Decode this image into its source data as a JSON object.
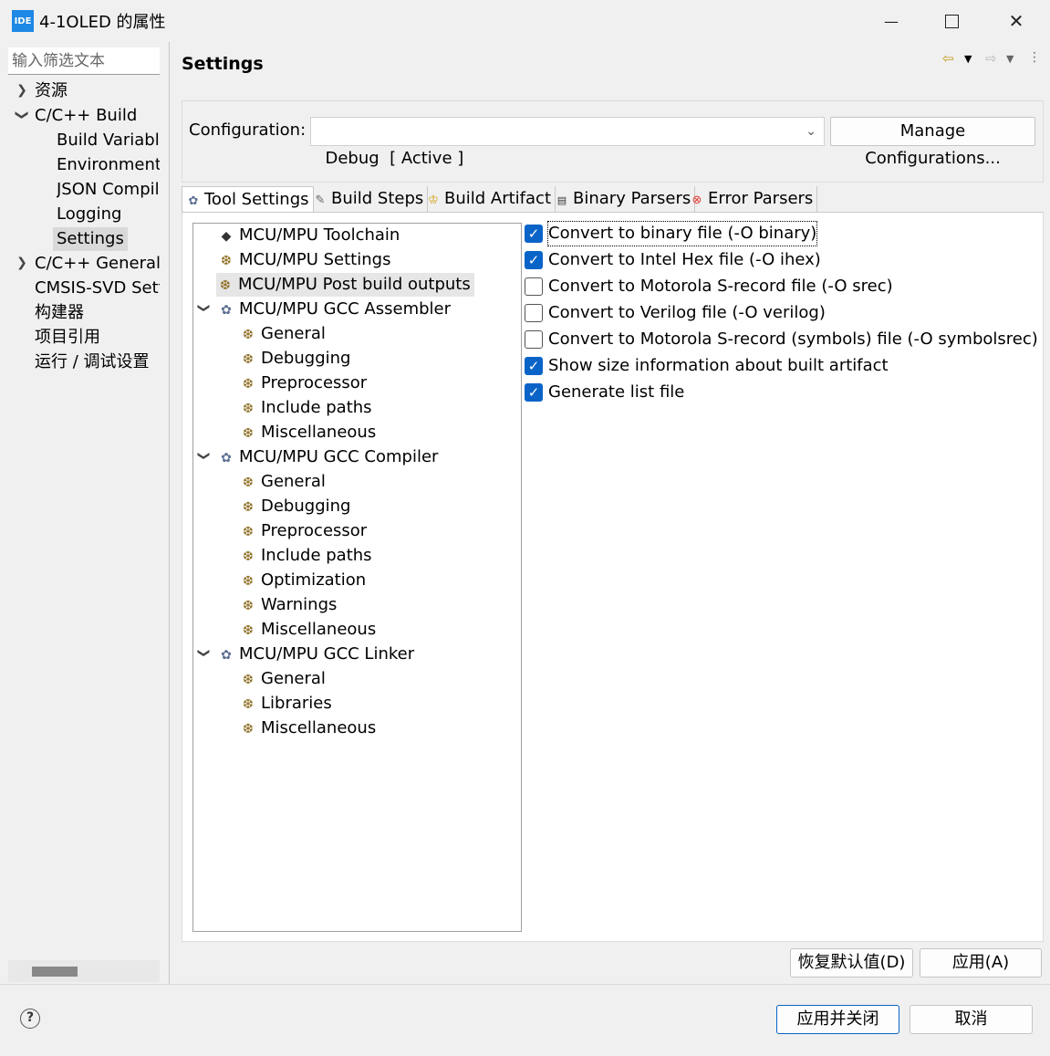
{
  "window": {
    "app_icon_label": "IDE",
    "title": "4-1OLED 的属性",
    "minimize_symbol": "—",
    "maximize_symbol": "☐",
    "close_symbol": "✕"
  },
  "left_nav": {
    "filter_placeholder": "输入筛选文本",
    "items": [
      {
        "label": "资源",
        "chevron": "right"
      },
      {
        "label": "C/C++ Build",
        "chevron": "down"
      },
      {
        "label": "Build Variables"
      },
      {
        "label": "Environment"
      },
      {
        "label": "JSON Compilation Database"
      },
      {
        "label": "Logging"
      },
      {
        "label": "Settings",
        "selected": true
      },
      {
        "label": "C/C++ General",
        "chevron": "right"
      },
      {
        "label": "CMSIS-SVD Settings"
      },
      {
        "label": "构建器"
      },
      {
        "label": "项目引用"
      },
      {
        "label": "运行 / 调试设置"
      }
    ]
  },
  "header": {
    "title": "Settings",
    "back_icon": "back-arrow-icon",
    "forward_icon": "forward-arrow-icon"
  },
  "configuration": {
    "label": "Configuration:",
    "selected": "Debug  [ Active ]",
    "manage_button": "Manage Configurations..."
  },
  "tabs": [
    {
      "label": "Tool Settings",
      "icon": "tool-settings-icon",
      "active": true
    },
    {
      "label": "Build Steps",
      "icon": "build-steps-icon"
    },
    {
      "label": "Build Artifact",
      "icon": "build-artifact-icon"
    },
    {
      "label": "Binary Parsers",
      "icon": "binary-parsers-icon"
    },
    {
      "label": "Error Parsers",
      "icon": "error-parsers-icon"
    }
  ],
  "tool_tree": [
    {
      "label": "MCU/MPU Toolchain",
      "icon": "toolchain-icon"
    },
    {
      "label": "MCU/MPU Settings",
      "icon": "option-category-icon"
    },
    {
      "label": "MCU/MPU Post build outputs",
      "icon": "option-category-icon",
      "selected": true
    },
    {
      "label": "MCU/MPU GCC Assembler",
      "icon": "tool-icon",
      "expanded": true
    },
    {
      "label": "General",
      "icon": "option-category-icon"
    },
    {
      "label": "Debugging",
      "icon": "option-category-icon"
    },
    {
      "label": "Preprocessor",
      "icon": "option-category-icon"
    },
    {
      "label": "Include paths",
      "icon": "option-category-icon"
    },
    {
      "label": "Miscellaneous",
      "icon": "option-category-icon"
    },
    {
      "label": "MCU/MPU GCC Compiler",
      "icon": "tool-icon",
      "expanded": true
    },
    {
      "label": "General",
      "icon": "option-category-icon"
    },
    {
      "label": "Debugging",
      "icon": "option-category-icon"
    },
    {
      "label": "Preprocessor",
      "icon": "option-category-icon"
    },
    {
      "label": "Include paths",
      "icon": "option-category-icon"
    },
    {
      "label": "Optimization",
      "icon": "option-category-icon"
    },
    {
      "label": "Warnings",
      "icon": "option-category-icon"
    },
    {
      "label": "Miscellaneous",
      "icon": "option-category-icon"
    },
    {
      "label": "MCU/MPU GCC Linker",
      "icon": "tool-icon",
      "expanded": true
    },
    {
      "label": "General",
      "icon": "option-category-icon"
    },
    {
      "label": "Libraries",
      "icon": "option-category-icon"
    },
    {
      "label": "Miscellaneous",
      "icon": "option-category-icon"
    }
  ],
  "options": [
    {
      "label": "Convert to binary file (-O binary)",
      "checked": true
    },
    {
      "label": "Convert to Intel Hex file (-O ihex)",
      "checked": true
    },
    {
      "label": "Convert to Motorola S-record file (-O srec)",
      "checked": false
    },
    {
      "label": "Convert to Verilog file (-O verilog)",
      "checked": false
    },
    {
      "label": "Convert to Motorola S-record (symbols) file (-O symbolsrec)",
      "checked": false
    },
    {
      "label": "Show size information about built artifact",
      "checked": true
    },
    {
      "label": "Generate list file",
      "checked": true
    }
  ],
  "page_buttons": {
    "restore_defaults": "恢复默认值(D)",
    "apply": "应用(A)"
  },
  "dialog_buttons": {
    "apply_and_close": "应用并关闭",
    "cancel": "取消"
  },
  "colors": {
    "accent": "#0a64c8",
    "selection": "#d9d9d9",
    "app_icon": "#1e88e5"
  }
}
